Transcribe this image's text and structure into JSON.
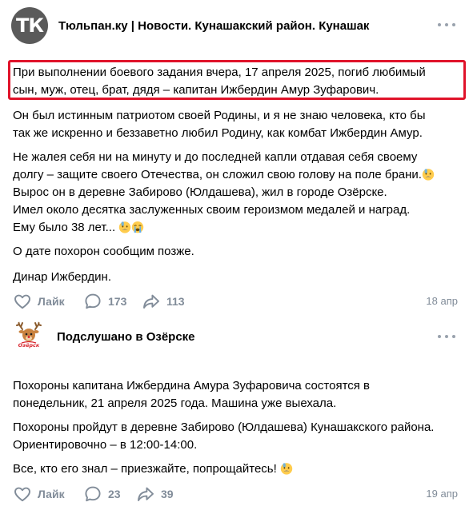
{
  "post1": {
    "avatar_text": "ТК",
    "group_name": "Тюльпан.ку | Новости. Кунашакский район. Кунашак",
    "highlight_color": "#e0132a",
    "lines": [
      "При выполнении боевого задания вчера, 17 апреля 2025, погиб любимый",
      "сын, муж, отец, брат, дядя – капитан Ижбердин Амур Зуфарович.",
      "Он был истинным патриотом своей Родины, и я не знаю человека, кто бы",
      "так же искренно и беззаветно любил Родину, как комбат Ижбердин Амур.",
      "Не жалея себя ни на минуту и до последней капли отдавая себя своему",
      "долгу – защите своего Отечества, он сложил свою голову на поле брани.",
      "Вырос он в деревне Забирово (Юлдашева), жил в городе Озёрске.",
      "Имел около десятка заслуженных своим героизмом медалей и наград.",
      "Ему было 38 лет...",
      "О дате похорон сообщим позже.",
      "Динар Ижбердин."
    ],
    "emoji_names": [
      "sad-sweat-emoji",
      "sad-sweat-emoji",
      "crying-emoji"
    ],
    "like_label": "Лайк",
    "comments_count": "173",
    "shares_count": "113",
    "date": "18 апр"
  },
  "post2": {
    "avatar_caption": "Озёрск",
    "group_name": "Подслушано в Озёрске",
    "lines": [
      "Похороны капитана Ижбердина Амура Зуфаровича состоятся в",
      "понедельник, 21 апреля 2025 года. Машина уже выехала.",
      "Похороны пройдут в деревне Забирово (Юлдашева) Кунашакского района.",
      "Ориентировочно – в 12:00-14:00.",
      "Все, кто его знал – приезжайте, попрощайтесь!"
    ],
    "emoji_names": [
      "sad-sweat-emoji"
    ],
    "like_label": "Лайк",
    "comments_count": "23",
    "shares_count": "39",
    "date": "19 апр"
  },
  "colors": {
    "meta_gray": "#818c99",
    "emoji_yellow": "#ffcc4d",
    "tear_blue": "#5dadec"
  }
}
